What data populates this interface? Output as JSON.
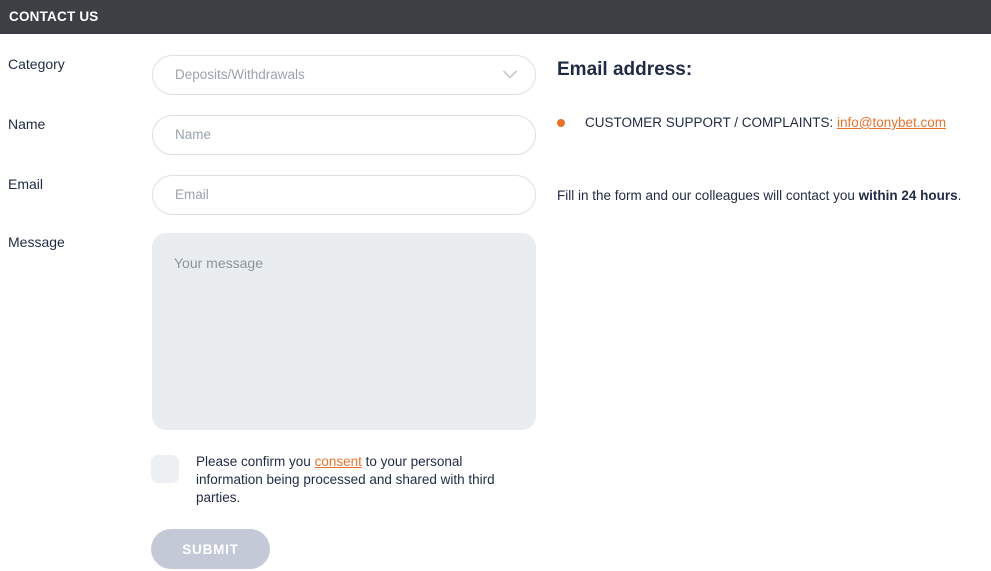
{
  "header": {
    "title": "CONTACT US",
    "bg_color": "#3c4044",
    "text_color": "#ffffff"
  },
  "theme": {
    "accent_orange": "#e8722c",
    "text_dark": "#1f2a44",
    "input_border": "#dcdfe3",
    "placeholder": "#9aa3ad",
    "textarea_bg": "#e9edef",
    "submit_bg": "#c3c9d6",
    "checkbox_bg": "#edf0f2"
  },
  "form": {
    "category": {
      "label": "Category",
      "selected_value": "Deposits/Withdrawals",
      "icon": "chevron-down-icon"
    },
    "name": {
      "label": "Name",
      "value": "",
      "placeholder": "Name"
    },
    "email": {
      "label": "Email",
      "value": "",
      "placeholder": "Email"
    },
    "message": {
      "label": "Message",
      "value": "",
      "placeholder": "Your message"
    },
    "consent": {
      "checked": false,
      "text_before": "Please confirm you ",
      "link_text": "consent",
      "text_after": " to your personal information being processed and shared with third parties."
    },
    "submit": {
      "label": "SUBMIT",
      "enabled": false
    }
  },
  "info": {
    "heading": "Email address:",
    "items": [
      {
        "prefix": "CUSTOMER SUPPORT / COMPLAINTS: ",
        "link_text": "info@tonybet.com",
        "bullet_icon": "bullet-dot-icon"
      }
    ],
    "note_before": "Fill in the form and our colleagues will contact you ",
    "note_bold": "within 24 hours",
    "note_after": "."
  }
}
